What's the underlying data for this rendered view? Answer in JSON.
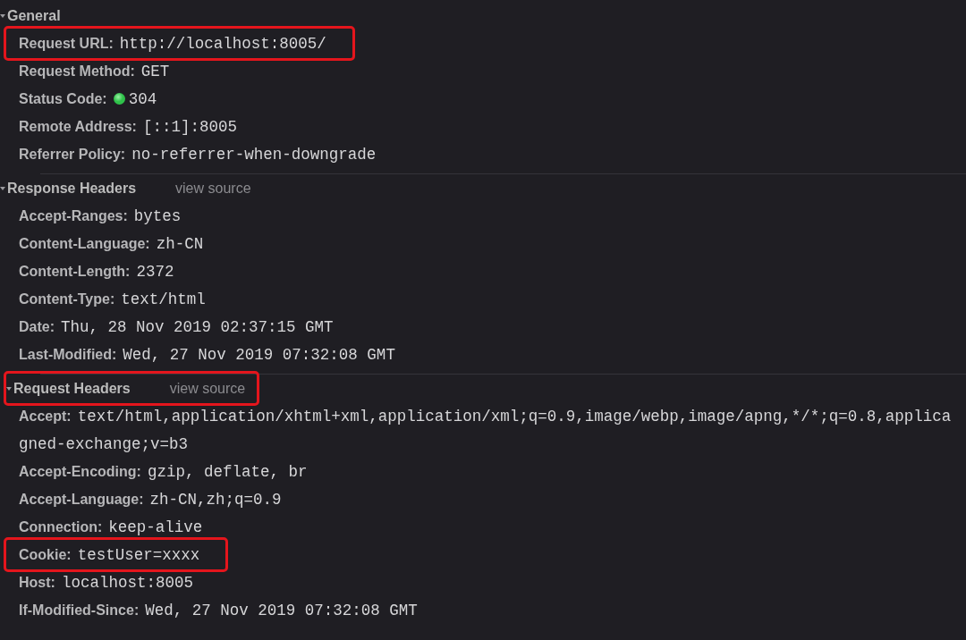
{
  "sections": [
    {
      "title": "General",
      "expanded": true,
      "highlighted": false,
      "rows": [
        {
          "name": "Request URL:",
          "value": "http://localhost:8005/",
          "highlighted": true
        },
        {
          "name": "Request Method:",
          "value": "GET",
          "highlighted": false
        },
        {
          "name": "Status Code:",
          "value": "304",
          "color": "#2fc24a",
          "highlighted": false
        },
        {
          "name": "Remote Address:",
          "value": "[::1]:8005",
          "highlighted": false
        },
        {
          "name": "Referrer Policy:",
          "value": "no-referrer-when-downgrade",
          "highlighted": false
        }
      ]
    },
    {
      "title": "Response Headers",
      "view_source": "view source",
      "expanded": true,
      "highlighted": false,
      "rows": [
        {
          "name": "Accept-Ranges:",
          "value": "bytes",
          "highlighted": false
        },
        {
          "name": "Content-Language:",
          "value": "zh-CN",
          "highlighted": false
        },
        {
          "name": "Content-Length:",
          "value": "2372",
          "highlighted": false
        },
        {
          "name": "Content-Type:",
          "value": "text/html",
          "highlighted": false
        },
        {
          "name": "Date:",
          "value": "Thu, 28 Nov 2019 02:37:15 GMT",
          "highlighted": false
        },
        {
          "name": "Last-Modified:",
          "value": "Wed, 27 Nov 2019 07:32:08 GMT",
          "highlighted": false
        }
      ]
    },
    {
      "title": "Request Headers",
      "view_source": "view source",
      "expanded": true,
      "highlighted": true,
      "rows": [
        {
          "name": "Accept:",
          "value": "text/html,application/xhtml+xml,application/xml;q=0.9,image/webp,image/apng,*/*;q=0.8,applica",
          "continuation": "gned-exchange;v=b3",
          "highlighted": false
        },
        {
          "name": "Accept-Encoding:",
          "value": "gzip, deflate, br",
          "highlighted": false
        },
        {
          "name": "Accept-Language:",
          "value": "zh-CN,zh;q=0.9",
          "highlighted": false
        },
        {
          "name": "Connection:",
          "value": "keep-alive",
          "highlighted": false
        },
        {
          "name": "Cookie:",
          "value": "testUser=xxxx",
          "highlighted": true
        },
        {
          "name": "Host:",
          "value": "localhost:8005",
          "highlighted": false
        },
        {
          "name": "If-Modified-Since:",
          "value": "Wed, 27 Nov 2019 07:32:08 GMT",
          "highlighted": false
        }
      ]
    }
  ]
}
